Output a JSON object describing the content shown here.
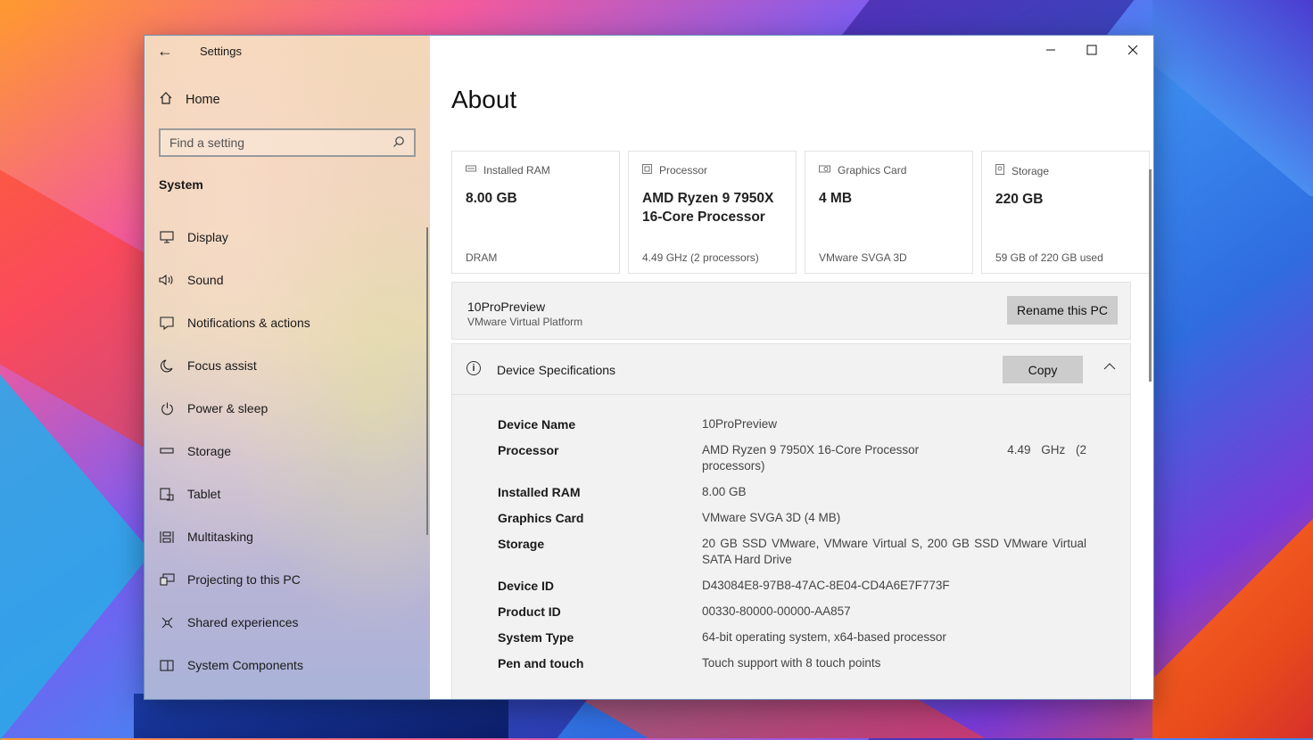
{
  "window": {
    "title": "Settings"
  },
  "sidebar": {
    "home_label": "Home",
    "search_placeholder": "Find a setting",
    "section": "System",
    "items": [
      {
        "label": "Display",
        "icon": "monitor-icon"
      },
      {
        "label": "Sound",
        "icon": "speaker-icon"
      },
      {
        "label": "Notifications & actions",
        "icon": "notification-icon"
      },
      {
        "label": "Focus assist",
        "icon": "moon-icon"
      },
      {
        "label": "Power & sleep",
        "icon": "power-icon"
      },
      {
        "label": "Storage",
        "icon": "storage-icon"
      },
      {
        "label": "Tablet",
        "icon": "tablet-icon"
      },
      {
        "label": "Multitasking",
        "icon": "multitasking-icon"
      },
      {
        "label": "Projecting to this PC",
        "icon": "projecting-icon"
      },
      {
        "label": "Shared experiences",
        "icon": "shared-icon"
      },
      {
        "label": "System Components",
        "icon": "components-icon"
      }
    ]
  },
  "main": {
    "title": "About",
    "cards": [
      {
        "label": "Installed RAM",
        "value": "8.00 GB",
        "sub": "DRAM",
        "icon": "ram-icon"
      },
      {
        "label": "Processor",
        "value": "AMD Ryzen 9 7950X 16-Core Processor",
        "sub": "4.49 GHz (2 processors)",
        "icon": "cpu-icon"
      },
      {
        "label": "Graphics Card",
        "value": "4 MB",
        "sub": "VMware SVGA 3D",
        "icon": "gpu-icon"
      },
      {
        "label": "Storage",
        "value": "220 GB",
        "sub": "59 GB of 220 GB used",
        "icon": "disk-icon"
      }
    ],
    "pc": {
      "name": "10ProPreview",
      "platform": "VMware Virtual Platform",
      "rename_label": "Rename this PC"
    },
    "specs": {
      "title": "Device Specifications",
      "copy_label": "Copy",
      "rows": [
        {
          "key": "Device Name",
          "value": "10ProPreview"
        },
        {
          "key": "Processor",
          "value": "AMD Ryzen 9 7950X 16-Core Processor",
          "value_right": "4.49 GHz (2",
          "value_cont": "processors)"
        },
        {
          "key": "Installed RAM",
          "value": "8.00 GB"
        },
        {
          "key": "Graphics Card",
          "value": "VMware SVGA 3D (4 MB)"
        },
        {
          "key": "Storage",
          "value": "20 GB SSD VMware, VMware Virtual S, 200 GB SSD VMware Virtual SATA Hard Drive"
        },
        {
          "key": "Device ID",
          "value": "D43084E8-97B8-47AC-8E04-CD4A6E7F773F"
        },
        {
          "key": "Product ID",
          "value": "00330-80000-00000-AA857"
        },
        {
          "key": "System Type",
          "value": "64-bit operating system, x64-based processor"
        },
        {
          "key": "Pen and touch",
          "value": "Touch support with 8 touch points"
        }
      ]
    }
  }
}
